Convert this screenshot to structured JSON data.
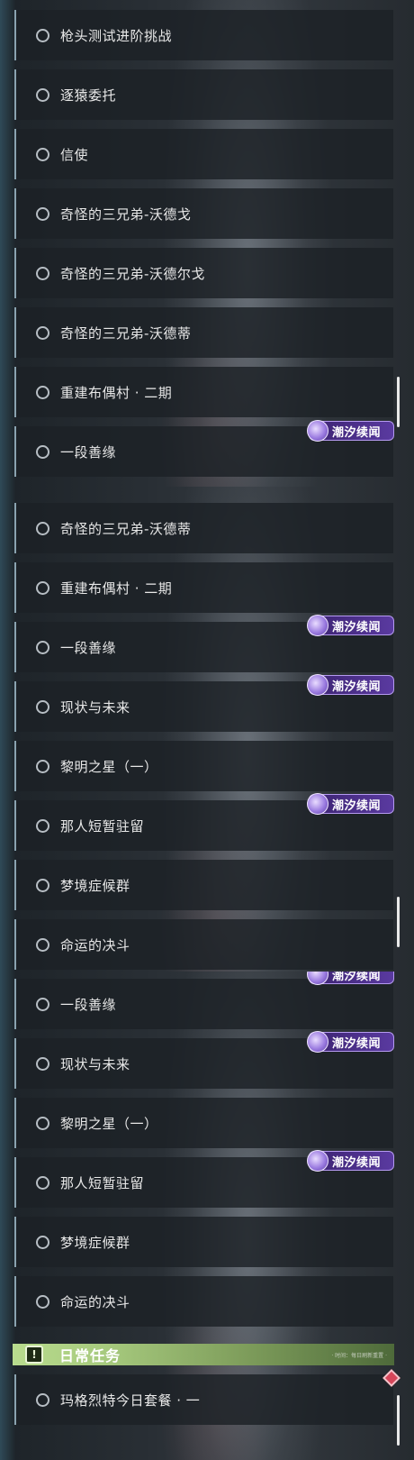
{
  "badge_label": "潮汐续闻",
  "panels": [
    {
      "items": [
        "枪头测试进阶挑战",
        "逐猿委托",
        "信使",
        "奇怪的三兄弟-沃德戈",
        "奇怪的三兄弟-沃德尔戈",
        "奇怪的三兄弟-沃德蒂",
        "重建布偶村 · 二期",
        "一段善缘"
      ]
    },
    {
      "items": [
        "奇怪的三兄弟-沃德蒂",
        "重建布偶村 · 二期",
        "一段善缘",
        "现状与未来",
        "黎明之星（一）",
        "那人短暂驻留",
        "梦境症候群",
        "命运的决斗"
      ]
    },
    {
      "items": [
        "一段善缘",
        "现状与未来",
        "黎明之星（一）",
        "那人短暂驻留",
        "梦境症候群",
        "命运的决斗"
      ]
    }
  ],
  "daily_section": {
    "title": "日常任务",
    "icon": "exclamation-icon",
    "small_text": "· 时间：每日刷新重置 ·",
    "items": [
      "玛格烈特今日套餐 · 一"
    ]
  }
}
